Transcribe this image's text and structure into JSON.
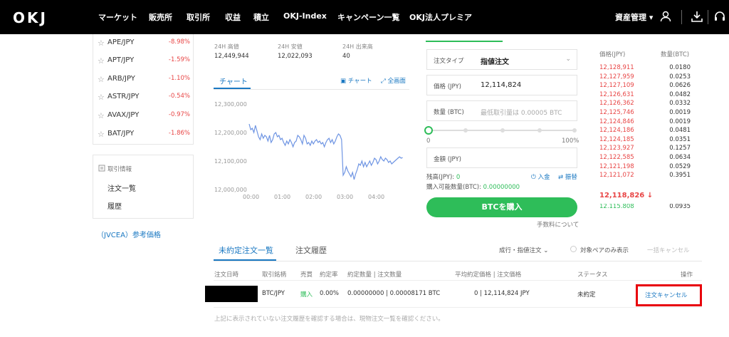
{
  "nav": {
    "logo": "OKJ",
    "items": [
      "マーケット",
      "販売所",
      "取引所",
      "収益",
      "積立",
      "OKJ-Index",
      "キャンペーン一覧",
      "OKJ法人プレミア"
    ],
    "asset_menu": "資産管理"
  },
  "pairs": [
    {
      "symbol": "APE/JPY",
      "change": "-8.98%"
    },
    {
      "symbol": "APT/JPY",
      "change": "-1.59%"
    },
    {
      "symbol": "ARB/JPY",
      "change": "-1.10%"
    },
    {
      "symbol": "ASTR/JPY",
      "change": "-0.54%"
    },
    {
      "symbol": "AVAX/JPY",
      "change": "-0.97%"
    },
    {
      "symbol": "BAT/JPY",
      "change": "-1.86%"
    }
  ],
  "trade_info": {
    "heading": "取引情報",
    "order_list": "注文一覧",
    "history": "履歴"
  },
  "jvcea_link": "（JVCEA）参考価格",
  "stats": {
    "high_label": "24H 高値",
    "high": "12,449,944",
    "low_label": "24H 安値",
    "low": "12,022,093",
    "volume_label": "24H 出来高",
    "volume": "40"
  },
  "chart_panel": {
    "tab": "チャート",
    "chart_link": "チャート",
    "fullscreen_link": "全画面"
  },
  "chart_data": {
    "type": "line",
    "yticks": [
      "12,300,000",
      "12,200,000",
      "12,100,000",
      "12,000,000"
    ],
    "xticks": [
      "00:00",
      "01:00",
      "02:00",
      "03:00",
      "04:00"
    ],
    "ylim": [
      12000000,
      12300000
    ],
    "x": [
      0,
      0.05,
      0.1,
      0.15,
      0.2,
      0.25,
      0.3,
      0.35,
      0.4,
      0.45,
      0.5,
      0.55,
      0.6,
      0.65,
      0.7,
      0.75,
      0.8,
      0.85,
      0.9,
      0.95,
      1.0,
      1.05,
      1.1,
      1.15,
      1.2,
      1.25,
      1.3,
      1.35,
      1.4,
      1.45,
      1.5,
      1.55,
      1.6,
      1.65,
      1.7,
      1.75,
      1.8,
      1.85,
      1.9,
      1.95,
      2.0,
      2.05,
      2.1,
      2.15,
      2.2,
      2.25,
      2.3,
      2.35,
      2.4,
      2.45,
      2.5,
      2.55,
      2.6,
      2.65,
      2.7,
      2.75,
      2.8,
      2.85,
      2.9,
      2.95,
      3.0,
      3.05,
      3.1,
      3.15,
      3.2,
      3.25,
      3.3,
      3.35,
      3.4,
      3.45,
      3.5,
      3.55,
      3.6,
      3.65,
      3.7,
      3.75,
      3.8,
      3.85,
      3.9,
      3.95,
      4.0,
      4.05,
      4.1,
      4.15,
      4.2,
      4.25,
      4.3,
      4.35,
      4.4,
      4.45,
      4.5,
      4.55,
      4.6,
      4.65,
      4.7,
      4.75,
      4.8,
      4.85,
      4.9
    ],
    "values": [
      12230000,
      12210000,
      12215000,
      12200000,
      12225000,
      12205000,
      12185000,
      12175000,
      12195000,
      12180000,
      12190000,
      12185000,
      12170000,
      12190000,
      12165000,
      12175000,
      12195000,
      12200000,
      12185000,
      12190000,
      12175000,
      12180000,
      12165000,
      12155000,
      12170000,
      12160000,
      12175000,
      12165000,
      12150000,
      12165000,
      12170000,
      12190000,
      12185000,
      12175000,
      12160000,
      12190000,
      12180000,
      12160000,
      12165000,
      12155000,
      12170000,
      12160000,
      12170000,
      12175000,
      12165000,
      12170000,
      12160000,
      12165000,
      12150000,
      12165000,
      12175000,
      12180000,
      12165000,
      12175000,
      12160000,
      12170000,
      12185000,
      12195000,
      12190000,
      12175000,
      12050000,
      12060000,
      12080000,
      12065000,
      12055000,
      12045000,
      12060000,
      12035000,
      12055000,
      12070000,
      12090000,
      12085000,
      12100000,
      12080000,
      12095000,
      12080000,
      12090000,
      12100000,
      12085000,
      12095000,
      12110000,
      12105000,
      12090000,
      12100000,
      12115000,
      12105000,
      12100000,
      12110000,
      12105000,
      12095000,
      12100000,
      12090000,
      12095000,
      12100000,
      12105000,
      12110000,
      12115000,
      12110000,
      12112000
    ]
  },
  "order_form": {
    "type_label": "注文タイプ",
    "type_value": "指値注文",
    "price_label": "価格 (JPY)",
    "price_value": "12,114,824",
    "qty_label": "数量 (BTC)",
    "qty_placeholder": "最低取引量は 0.00005 BTC",
    "slider_min": "0",
    "slider_max": "100%",
    "amount_label": "金額 (JPY)",
    "balance_label": "残高(JPY):",
    "balance_value": "0",
    "deposit": "入金",
    "transfer": "振替",
    "available_label": "購入可能数量(BTC):",
    "available_value": "0.00000000",
    "buy_button": "BTCを購入",
    "fee_link": "手数料について"
  },
  "order_book": {
    "price_header": "価格(JPY)",
    "qty_header": "数量(BTC)",
    "asks": [
      {
        "price": "12,128,911",
        "qty": "0.0180"
      },
      {
        "price": "12,127,959",
        "qty": "0.0253"
      },
      {
        "price": "12,127,109",
        "qty": "0.0626"
      },
      {
        "price": "12,126,631",
        "qty": "0.0482"
      },
      {
        "price": "12,126,362",
        "qty": "0.0332"
      },
      {
        "price": "12,125,746",
        "qty": "0.0019"
      },
      {
        "price": "12,124,846",
        "qty": "0.0019"
      },
      {
        "price": "12,124,186",
        "qty": "0.0481"
      },
      {
        "price": "12,124,185",
        "qty": "0.0351"
      },
      {
        "price": "12,123,927",
        "qty": "0.1257"
      },
      {
        "price": "12,122,585",
        "qty": "0.0634"
      },
      {
        "price": "12,121,198",
        "qty": "0.0529"
      },
      {
        "price": "12,121,072",
        "qty": "0.3951"
      }
    ],
    "last_price": "12,118,826 ↓",
    "bid_partial": {
      "price": "12,115,808",
      "qty": "0.0935"
    }
  },
  "orders": {
    "tab_open": "未約定注文一覧",
    "tab_history": "注文履歴",
    "filter_select": "成行・指値注文",
    "filter_pair": "対象ペアのみ表示",
    "bulk_cancel": "一括キャンセル",
    "headers": [
      "注文日時",
      "取引銘柄",
      "売買",
      "約定率",
      "約定数量 | 注文数量",
      "平均約定価格 | 注文価格",
      "ステータス",
      "操作"
    ],
    "row": {
      "pair": "BTC/JPY",
      "side": "購入",
      "rate": "0.00%",
      "qty": "0.00000000 | 0.00008171 BTC",
      "price": "0 | 12,114,824 JPY",
      "status": "未約定",
      "action": "注文キャンセル"
    },
    "note": "上記に表示されていない注文履歴を確認する場合は、現物注文一覧を確認ください。"
  }
}
